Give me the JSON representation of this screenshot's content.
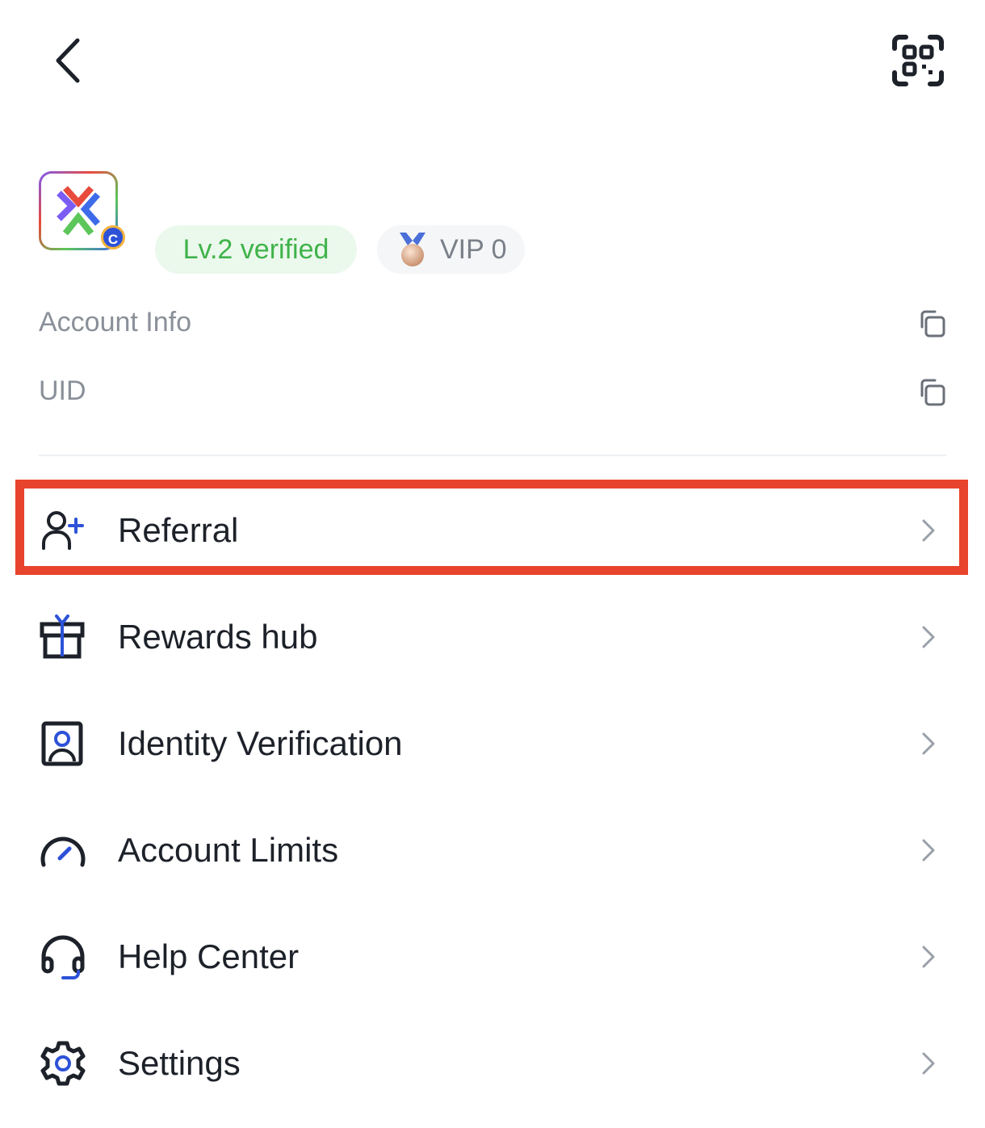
{
  "header": {
    "back_icon": "chevron-left-icon",
    "scan_icon": "qr-scan-icon"
  },
  "profile": {
    "avatar_badge": "C",
    "verification_badge": "Lv.2 verified",
    "vip_badge": "VIP 0"
  },
  "account": {
    "info_label": "Account Info",
    "uid_label": "UID"
  },
  "menu": {
    "items": [
      {
        "label": "Referral",
        "icon": "add-user-icon"
      },
      {
        "label": "Rewards hub",
        "icon": "gift-icon"
      },
      {
        "label": "Identity Verification",
        "icon": "id-card-icon"
      },
      {
        "label": "Account Limits",
        "icon": "gauge-icon"
      },
      {
        "label": "Help Center",
        "icon": "headset-icon"
      },
      {
        "label": "Settings",
        "icon": "gear-icon"
      }
    ]
  },
  "colors": {
    "accent": "#2d52d8",
    "verified_green": "#3fb34a",
    "highlight_red": "#e8432c"
  }
}
